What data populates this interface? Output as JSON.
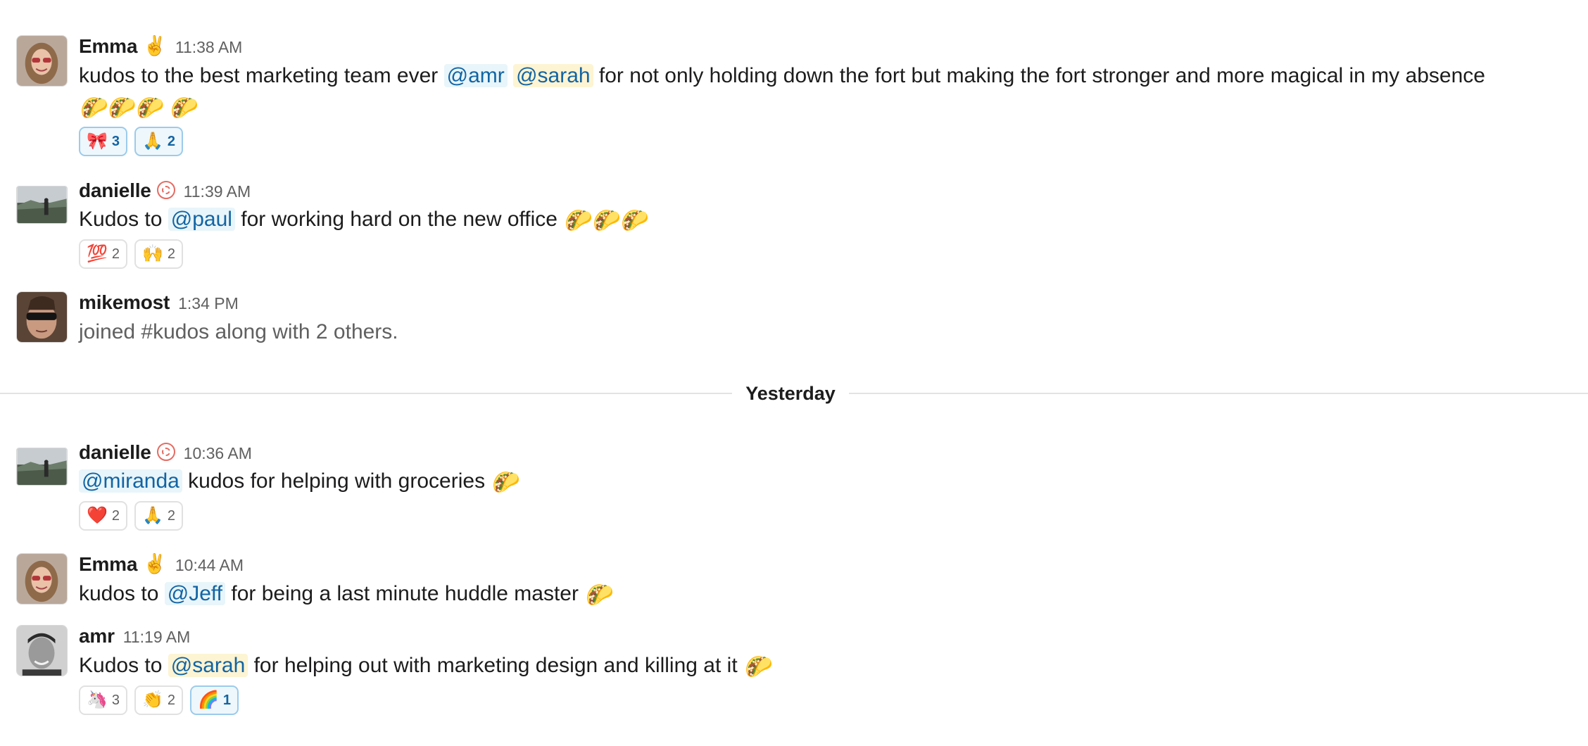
{
  "messages": [
    {
      "author": "Emma",
      "status_emoji": "✌️",
      "time": "11:38 AM",
      "segments": {
        "t0": "kudos to the best marketing team ever ",
        "m0": "@amr",
        "t1": " ",
        "m1": "@sarah",
        "t2": " for not only holding down the fort but making the fort stronger and more magical in my absence ",
        "emoji": "🌮🌮🌮 🌮"
      },
      "reactions": [
        {
          "emoji": "🎀",
          "count": "3"
        },
        {
          "emoji": "🙏",
          "count": "2"
        }
      ]
    },
    {
      "author": "danielle",
      "time": "11:39 AM",
      "segments": {
        "t0": "Kudos to ",
        "m0": "@paul",
        "t1": " for working hard on the new office ",
        "emoji": "🌮🌮🌮"
      },
      "reactions": [
        {
          "emoji": "💯",
          "count": "2"
        },
        {
          "emoji": "🙌",
          "count": "2"
        }
      ]
    },
    {
      "author": "mikemost",
      "time": "1:34 PM",
      "segments": {
        "t0": "joined #kudos along with 2 others."
      }
    },
    {
      "author": "danielle",
      "time": "10:36 AM",
      "segments": {
        "m0": "@miranda",
        "t0": " kudos for helping with groceries ",
        "emoji": "🌮"
      },
      "reactions": [
        {
          "emoji": "❤️",
          "count": "2"
        },
        {
          "emoji": "🙏",
          "count": "2"
        }
      ]
    },
    {
      "author": "Emma",
      "status_emoji": "✌️",
      "time": "10:44 AM",
      "segments": {
        "t0": "kudos to ",
        "m0": "@Jeff",
        "t1": " for being a last minute huddle master ",
        "emoji": "🌮"
      }
    },
    {
      "author": "amr",
      "time": "11:19 AM",
      "segments": {
        "t0": "Kudos to ",
        "m0": "@sarah",
        "t1": " for helping out with marketing design and killing at it ",
        "emoji": "🌮"
      },
      "reactions": [
        {
          "emoji": "🦄",
          "count": "3"
        },
        {
          "emoji": "👏",
          "count": "2"
        },
        {
          "emoji": "🌈",
          "count": "1"
        }
      ]
    }
  ],
  "divider_label": "Yesterday",
  "colors": {
    "mention_text": "#1264a3",
    "mention_bg": "#e8f5fa",
    "self_mention_bg": "#fdf4d3",
    "active_reaction_border": "#9ccbeb"
  }
}
